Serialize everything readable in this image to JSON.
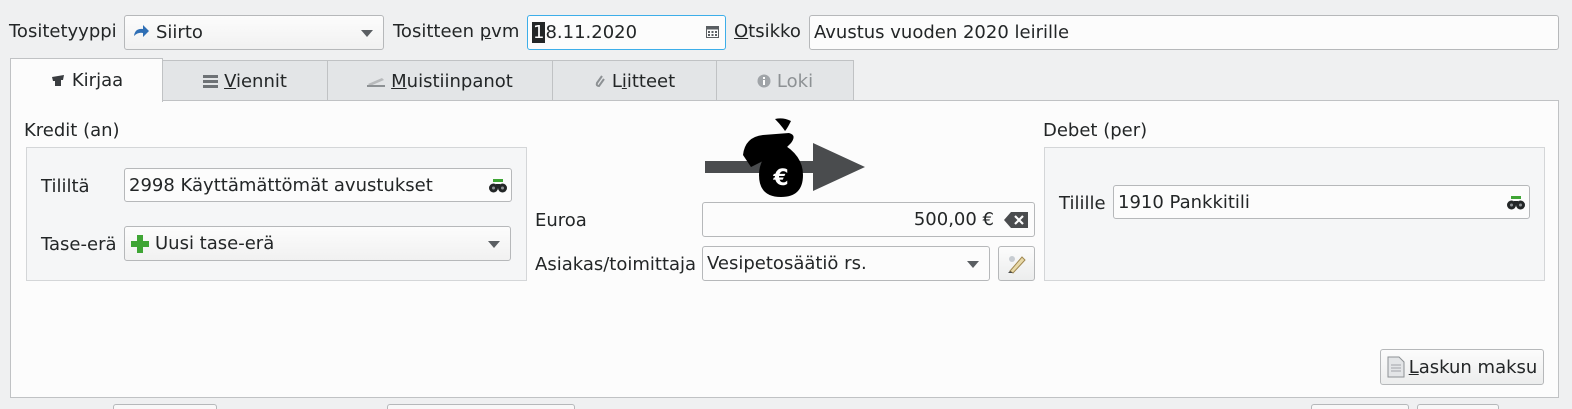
{
  "header": {
    "type_label": "Tositetyyppi",
    "type_value": "Siirto",
    "date_label_pre": "Tositteen ",
    "date_label_ul": "p",
    "date_label_post": "vm",
    "date_cursor_char": "1",
    "date_value_rest": "8.11.2020",
    "title_label_ul": "O",
    "title_label_post": "tsikko",
    "title_value": "Avustus vuoden 2020 leirille"
  },
  "tabs": [
    {
      "pre": "",
      "ul": "",
      "post": "Kirjaa",
      "icon": "hat-icon",
      "active": true
    },
    {
      "pre": "",
      "ul": "V",
      "post": "iennit",
      "icon": "list-icon"
    },
    {
      "pre": "",
      "ul": "M",
      "post": "uistiinpanot",
      "icon": "note-icon"
    },
    {
      "pre": "L",
      "ul": "i",
      "post": "itteet",
      "icon": "paperclip-icon"
    },
    {
      "pre": "",
      "ul": "",
      "post": "Loki",
      "icon": "info-icon",
      "disabled": true
    }
  ],
  "credit": {
    "title": "Kredit (an)",
    "account_label": "Tililtä",
    "account_value": "2998 Käyttämättömät avustukset",
    "balance_label": "Tase-erä",
    "balance_value": "Uusi tase-erä"
  },
  "middle": {
    "amount_label": "Euroa",
    "amount_value": "500,00 €",
    "customer_label": "Asiakas/toimittaja",
    "customer_value": "Vesipetosäätiö rs."
  },
  "debit": {
    "title": "Debet (per)",
    "account_label": "Tilille",
    "account_value": "1910 Pankkitili"
  },
  "footer": {
    "invoice_button_ul": "L",
    "invoice_button_post": "askun maksu"
  },
  "colors": {
    "accent": "#3daee9",
    "background": "#eff0f1",
    "panel": "#fcfcfc",
    "plus_green": "#3fa535"
  }
}
